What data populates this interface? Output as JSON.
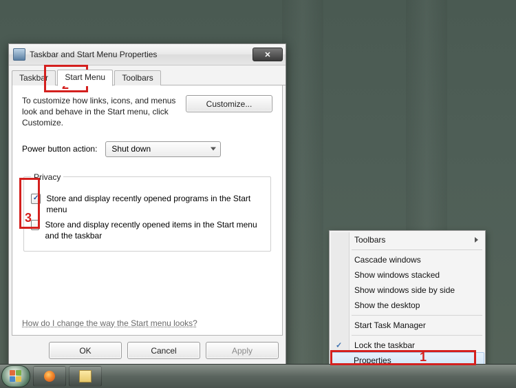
{
  "dialog": {
    "title": "Taskbar and Start Menu Properties",
    "tabs": {
      "taskbar": "Taskbar",
      "startmenu": "Start Menu",
      "toolbars": "Toolbars"
    },
    "desc": "To customize how links, icons, and menus look and behave in the Start menu, click Customize.",
    "customize_btn": "Customize...",
    "power_label": "Power button action:",
    "power_value": "Shut down",
    "privacy": {
      "legend": "Privacy",
      "opt_programs": "Store and display recently opened programs in the Start menu",
      "opt_items": "Store and display recently opened items in the Start menu and the taskbar"
    },
    "help_link": "How do I change the way the Start menu looks?",
    "buttons": {
      "ok": "OK",
      "cancel": "Cancel",
      "apply": "Apply"
    }
  },
  "context_menu": {
    "toolbars": "Toolbars",
    "cascade": "Cascade windows",
    "stacked": "Show windows stacked",
    "sidebyside": "Show windows side by side",
    "desktop": "Show the desktop",
    "taskmgr": "Start Task Manager",
    "lock": "Lock the taskbar",
    "properties": "Properties"
  },
  "annotations": {
    "one": "1",
    "two": "2",
    "three": "3"
  }
}
